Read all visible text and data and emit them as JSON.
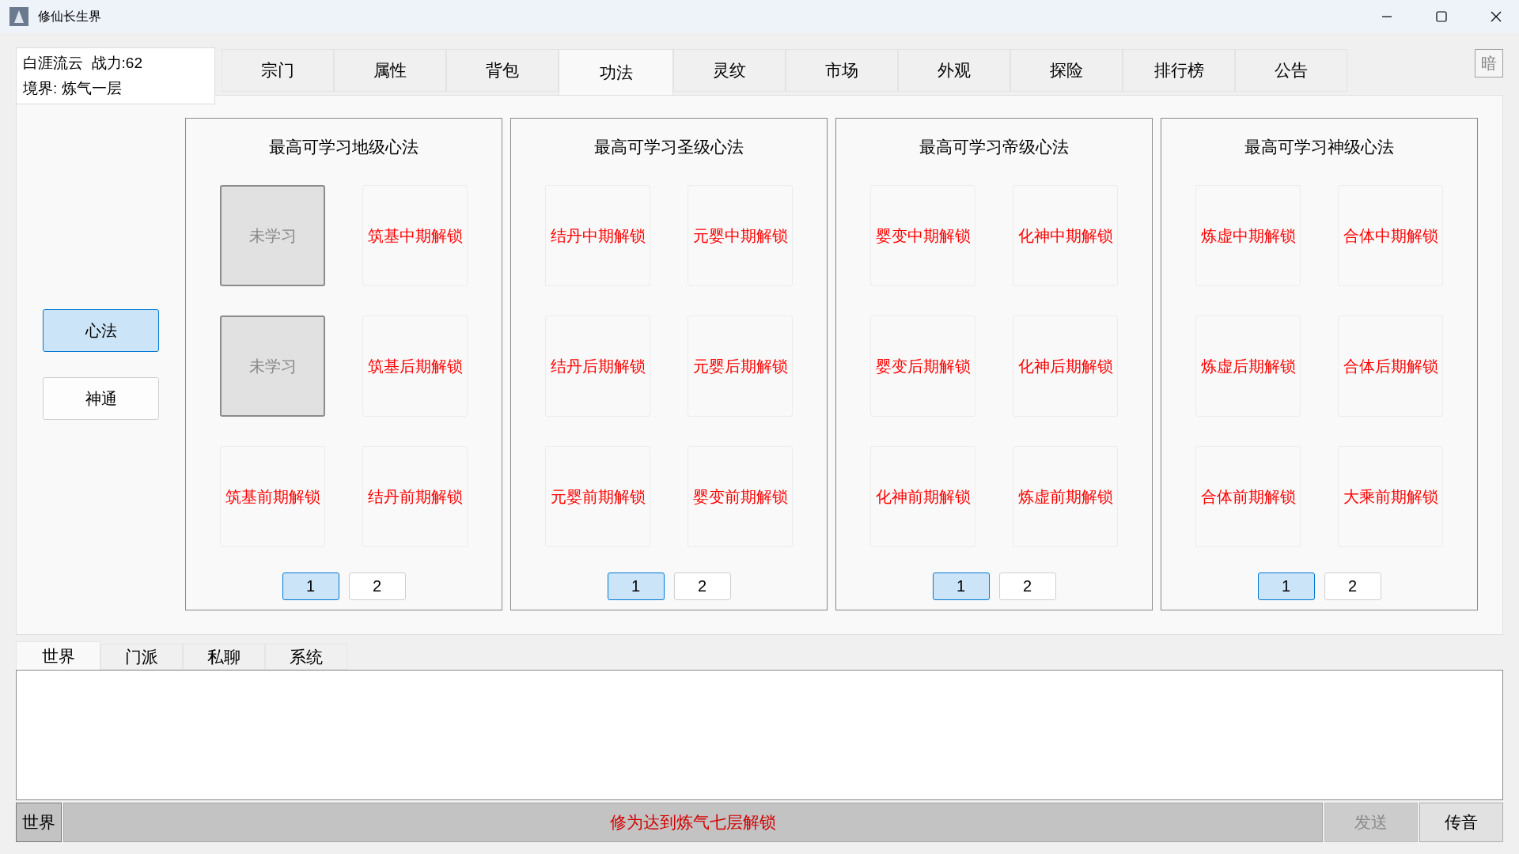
{
  "window": {
    "title": "修仙长生界"
  },
  "player": {
    "name_power": "白涯流云  战力:62",
    "realm": "境界: 炼气一层"
  },
  "tabs": [
    {
      "label": "宗门",
      "selected": false
    },
    {
      "label": "属性",
      "selected": false
    },
    {
      "label": "背包",
      "selected": false
    },
    {
      "label": "功法",
      "selected": true
    },
    {
      "label": "灵纹",
      "selected": false
    },
    {
      "label": "市场",
      "selected": false
    },
    {
      "label": "外观",
      "selected": false
    },
    {
      "label": "探险",
      "selected": false
    },
    {
      "label": "排行榜",
      "selected": false
    },
    {
      "label": "公告",
      "selected": false
    }
  ],
  "theme_button": "暗",
  "side_buttons": [
    {
      "label": "心法",
      "selected": true
    },
    {
      "label": "神通",
      "selected": false
    }
  ],
  "panels": [
    {
      "title": "最高可学习地级心法",
      "slots": [
        {
          "kind": "unlearned",
          "label": "未学习"
        },
        {
          "kind": "locked",
          "label": "筑基中期解锁"
        },
        {
          "kind": "unlearned",
          "label": "未学习"
        },
        {
          "kind": "locked",
          "label": "筑基后期解锁"
        },
        {
          "kind": "locked",
          "label": "筑基前期解锁"
        },
        {
          "kind": "locked",
          "label": "结丹前期解锁"
        }
      ],
      "pages": [
        {
          "label": "1",
          "selected": true
        },
        {
          "label": "2",
          "selected": false
        }
      ]
    },
    {
      "title": "最高可学习圣级心法",
      "slots": [
        {
          "kind": "locked",
          "label": "结丹中期解锁"
        },
        {
          "kind": "locked",
          "label": "元婴中期解锁"
        },
        {
          "kind": "locked",
          "label": "结丹后期解锁"
        },
        {
          "kind": "locked",
          "label": "元婴后期解锁"
        },
        {
          "kind": "locked",
          "label": "元婴前期解锁"
        },
        {
          "kind": "locked",
          "label": "婴变前期解锁"
        }
      ],
      "pages": [
        {
          "label": "1",
          "selected": true
        },
        {
          "label": "2",
          "selected": false
        }
      ]
    },
    {
      "title": "最高可学习帝级心法",
      "slots": [
        {
          "kind": "locked",
          "label": "婴变中期解锁"
        },
        {
          "kind": "locked",
          "label": "化神中期解锁"
        },
        {
          "kind": "locked",
          "label": "婴变后期解锁"
        },
        {
          "kind": "locked",
          "label": "化神后期解锁"
        },
        {
          "kind": "locked",
          "label": "化神前期解锁"
        },
        {
          "kind": "locked",
          "label": "炼虚前期解锁"
        }
      ],
      "pages": [
        {
          "label": "1",
          "selected": true
        },
        {
          "label": "2",
          "selected": false
        }
      ]
    },
    {
      "title": "最高可学习神级心法",
      "slots": [
        {
          "kind": "locked",
          "label": "炼虚中期解锁"
        },
        {
          "kind": "locked",
          "label": "合体中期解锁"
        },
        {
          "kind": "locked",
          "label": "炼虚后期解锁"
        },
        {
          "kind": "locked",
          "label": "合体后期解锁"
        },
        {
          "kind": "locked",
          "label": "合体前期解锁"
        },
        {
          "kind": "locked",
          "label": "大乘前期解锁"
        }
      ],
      "pages": [
        {
          "label": "1",
          "selected": true
        },
        {
          "label": "2",
          "selected": false
        }
      ]
    }
  ],
  "chat_tabs": [
    {
      "label": "世界",
      "selected": true
    },
    {
      "label": "门派",
      "selected": false
    },
    {
      "label": "私聊",
      "selected": false
    },
    {
      "label": "系统",
      "selected": false
    }
  ],
  "chat_bar": {
    "channel": "世界",
    "notice": "修为达到炼气七层解锁",
    "send": {
      "label": "发送",
      "disabled": true
    },
    "voice": "传音"
  }
}
